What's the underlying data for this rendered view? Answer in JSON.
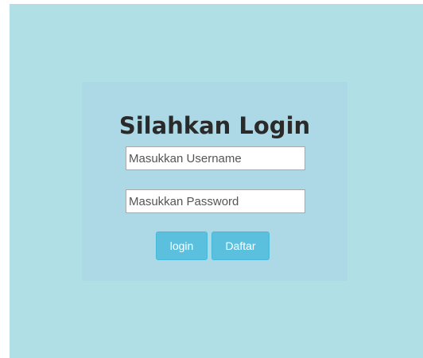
{
  "login": {
    "title": "Silahkan Login",
    "username_placeholder": "Masukkan Username",
    "password_placeholder": "Masukkan Password",
    "login_label": "login",
    "daftar_label": "Daftar"
  },
  "colors": {
    "background": "#b0dfe5",
    "panel": "#add8e6",
    "button": "#5bc0de"
  }
}
